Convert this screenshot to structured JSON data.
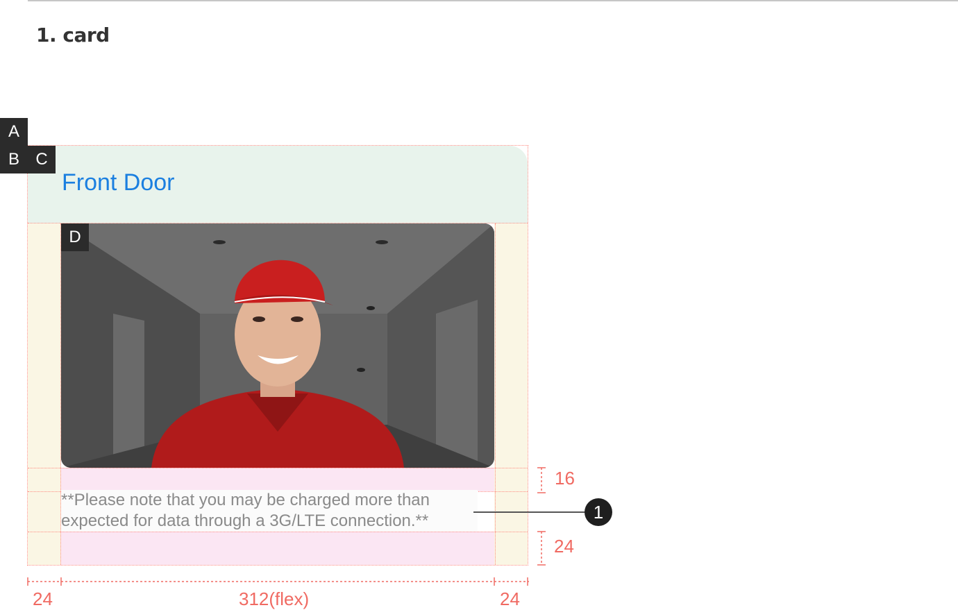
{
  "section": {
    "title": "1. card"
  },
  "tags": {
    "a": "A",
    "b": "B",
    "c": "C",
    "d": "D"
  },
  "card": {
    "title": "Front Door",
    "notice": "**Please note that you may be charged more than expected for data through a 3G/LTE connection.**",
    "image": "Woman in red cap and red polo shirt smiling in a hallway (door camera view)"
  },
  "specs": {
    "gap_top": "16",
    "gap_bottom": "24",
    "left_margin": "24",
    "content_width": "312(flex)",
    "right_margin": "24",
    "callout": "1"
  },
  "colors": {
    "title_blue": "#1b7fe0",
    "header_bg": "#e8f3ec",
    "margin_bg": "#faf6e4",
    "spacing_bg": "#fbe6f3",
    "spec_red": "#f06a62"
  }
}
